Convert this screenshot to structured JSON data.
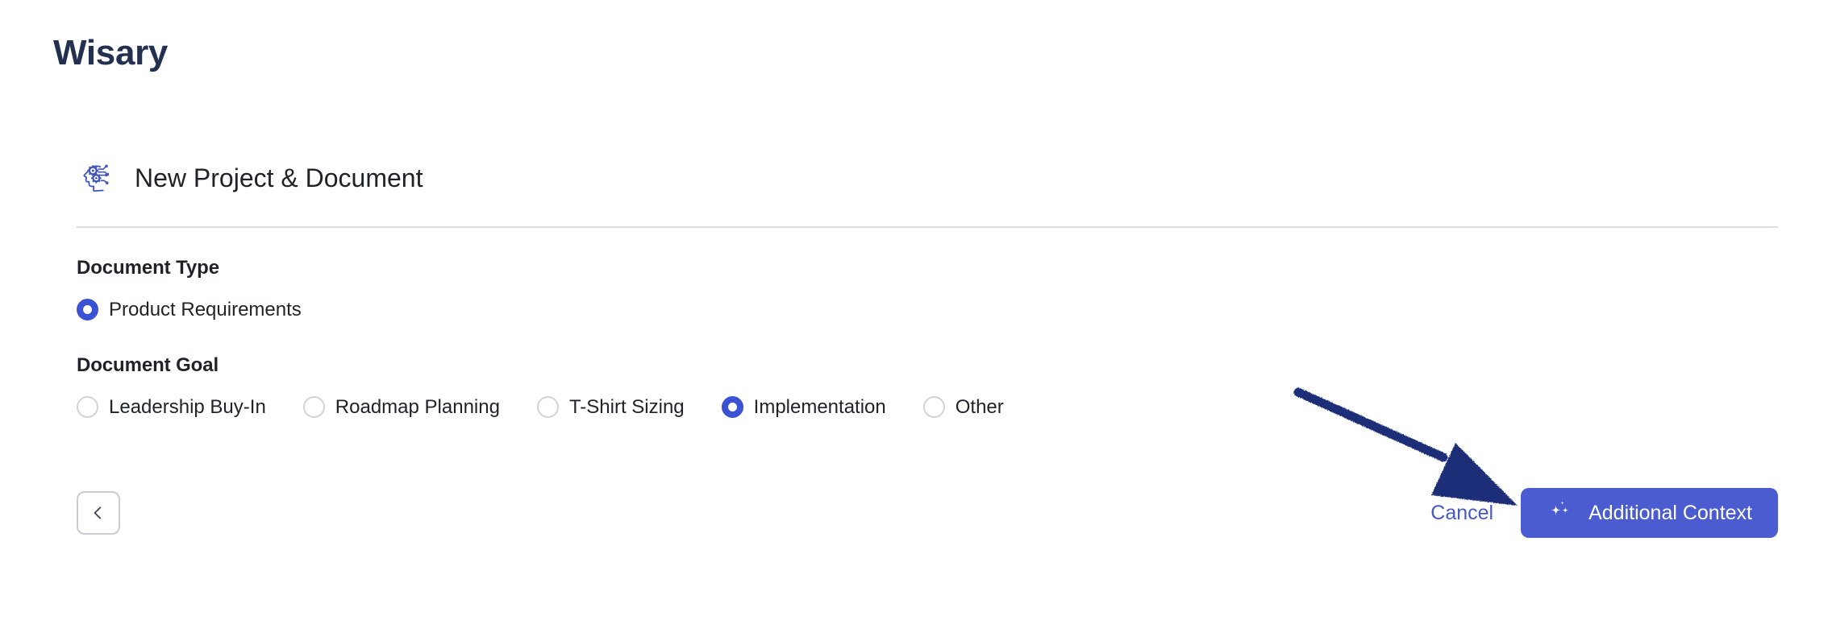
{
  "app": {
    "title": "Wisary"
  },
  "panel": {
    "icon": "ai-brain-icon",
    "header_title": "New Project & Document"
  },
  "document_type": {
    "label": "Document Type",
    "options": [
      {
        "label": "Product Requirements",
        "selected": true
      }
    ]
  },
  "document_goal": {
    "label": "Document Goal",
    "options": [
      {
        "label": "Leadership Buy-In",
        "selected": false
      },
      {
        "label": "Roadmap Planning",
        "selected": false
      },
      {
        "label": "T-Shirt Sizing",
        "selected": false
      },
      {
        "label": "Implementation",
        "selected": true
      },
      {
        "label": "Other",
        "selected": false
      }
    ]
  },
  "footer": {
    "back_label": "",
    "back_icon": "chevron-left-icon",
    "cancel_label": "Cancel",
    "primary_label": "Additional Context",
    "primary_icon": "sparkle-icon"
  },
  "annotation": {
    "type": "arrow",
    "points_to": "Additional Context",
    "color": "#1b2f77"
  },
  "colors": {
    "accent": "#4a5cd0",
    "radio_selected": "#3c52d4",
    "title": "#23304f",
    "link": "#4759c4",
    "divider": "#dcdde3",
    "icon_blue": "#4255bc"
  }
}
